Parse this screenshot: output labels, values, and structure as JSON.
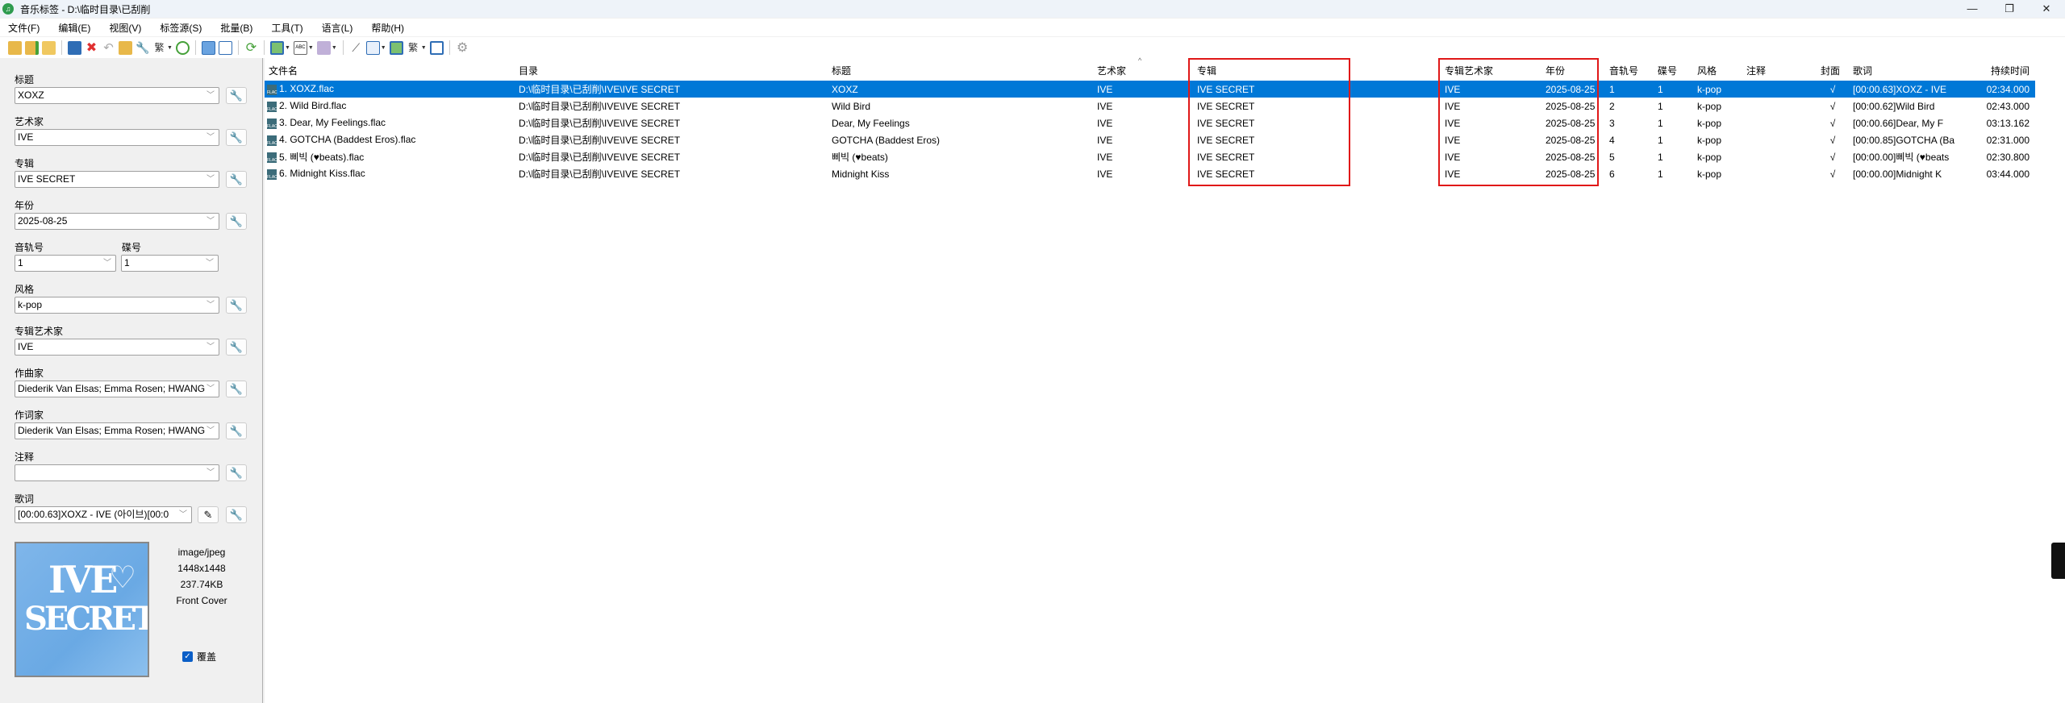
{
  "window": {
    "title": "音乐标签 - D:\\临时目录\\已刮削",
    "minimize": "—",
    "maximize": "❐",
    "close": "✕"
  },
  "menu": [
    "文件(F)",
    "编辑(E)",
    "视图(V)",
    "标签源(S)",
    "批量(B)",
    "工具(T)",
    "语言(L)",
    "帮助(H)"
  ],
  "toolbar": {
    "icons": [
      "open-folder",
      "add-folder",
      "open-folders",
      "save",
      "delete",
      "undo",
      "book",
      "wrench",
      "traditional-simplified",
      "history",
      "grid",
      "grid-alt",
      "refresh",
      "image",
      "text-abc",
      "tag-edit",
      "magic-wand",
      "file-save",
      "image-save",
      "traditional-simplified-2",
      "window",
      "settings"
    ],
    "colors": {
      "folder": "#e8b84a",
      "save": "#2f6db5",
      "delete": "#e03030",
      "green": "#46a13a",
      "gray": "#9a9a9a"
    }
  },
  "editor": {
    "title": {
      "label": "标题",
      "value": "XOXZ"
    },
    "artist": {
      "label": "艺术家",
      "value": "IVE"
    },
    "album": {
      "label": "专辑",
      "value": "IVE SECRET"
    },
    "year": {
      "label": "年份",
      "value": "2025-08-25"
    },
    "track": {
      "label": "音轨号",
      "value": "1"
    },
    "disc": {
      "label": "碟号",
      "value": "1"
    },
    "genre": {
      "label": "风格",
      "value": "k-pop"
    },
    "album_artist": {
      "label": "专辑艺术家",
      "value": "IVE"
    },
    "composer": {
      "label": "作曲家",
      "value": "Diederik Van Elsas; Emma Rosen; HWANG"
    },
    "lyricist": {
      "label": "作词家",
      "value": "Diederik Van Elsas; Emma Rosen; HWANG"
    },
    "comment": {
      "label": "注释",
      "value": ""
    },
    "lyrics": {
      "label": "歌词",
      "value": "[00:00.63]XOXZ - IVE (아이브)[00:0"
    },
    "cover": {
      "art_text": "IVE SECRET",
      "mime": "image/jpeg",
      "dimensions": "1448x1448",
      "size": "237.74KB",
      "type": "Front Cover"
    },
    "overwrite": {
      "label": "覆盖",
      "checked": true
    }
  },
  "table": {
    "columns": [
      "文件名",
      "目录",
      "标题",
      "艺术家",
      "专辑",
      "专辑艺术家",
      "年份",
      "音轨号",
      "碟号",
      "风格",
      "注释",
      "封面",
      "歌词",
      "持续时间"
    ],
    "selected_row": 0,
    "rows": [
      [
        "1. XOXZ.flac",
        "D:\\临时目录\\已刮削\\IVE\\IVE SECRET",
        "XOXZ",
        "IVE",
        "IVE SECRET",
        "IVE",
        "2025-08-25",
        "1",
        "1",
        "k-pop",
        "",
        "√",
        "[00:00.63]XOXZ - IVE",
        "02:34.000"
      ],
      [
        "2. Wild Bird.flac",
        "D:\\临时目录\\已刮削\\IVE\\IVE SECRET",
        "Wild Bird",
        "IVE",
        "IVE SECRET",
        "IVE",
        "2025-08-25",
        "2",
        "1",
        "k-pop",
        "",
        "√",
        "[00:00.62]Wild Bird",
        "02:43.000"
      ],
      [
        "3. Dear, My Feelings.flac",
        "D:\\临时目录\\已刮削\\IVE\\IVE SECRET",
        "Dear, My Feelings",
        "IVE",
        "IVE SECRET",
        "IVE",
        "2025-08-25",
        "3",
        "1",
        "k-pop",
        "",
        "√",
        "[00:00.66]Dear, My F",
        "03:13.162"
      ],
      [
        "4. GOTCHA (Baddest Eros).flac",
        "D:\\临时目录\\已刮削\\IVE\\IVE SECRET",
        "GOTCHA (Baddest Eros)",
        "IVE",
        "IVE SECRET",
        "IVE",
        "2025-08-25",
        "4",
        "1",
        "k-pop",
        "",
        "√",
        "[00:00.85]GOTCHA (Ba",
        "02:31.000"
      ],
      [
        "5. 삐빅 (♥beats).flac",
        "D:\\临时目录\\已刮削\\IVE\\IVE SECRET",
        "삐빅 (♥beats)",
        "IVE",
        "IVE SECRET",
        "IVE",
        "2025-08-25",
        "5",
        "1",
        "k-pop",
        "",
        "√",
        "[00:00.00]삐빅 (♥beats",
        "02:30.800"
      ],
      [
        "6. Midnight Kiss.flac",
        "D:\\临时目录\\已刮削\\IVE\\IVE SECRET",
        "Midnight Kiss",
        "IVE",
        "IVE SECRET",
        "IVE",
        "2025-08-25",
        "6",
        "1",
        "k-pop",
        "",
        "√",
        "[00:00.00]Midnight K",
        "03:44.000"
      ]
    ],
    "selection_color": "#0078d7",
    "highlight_color": "#e01818",
    "file_icon": "flac-file-icon"
  }
}
